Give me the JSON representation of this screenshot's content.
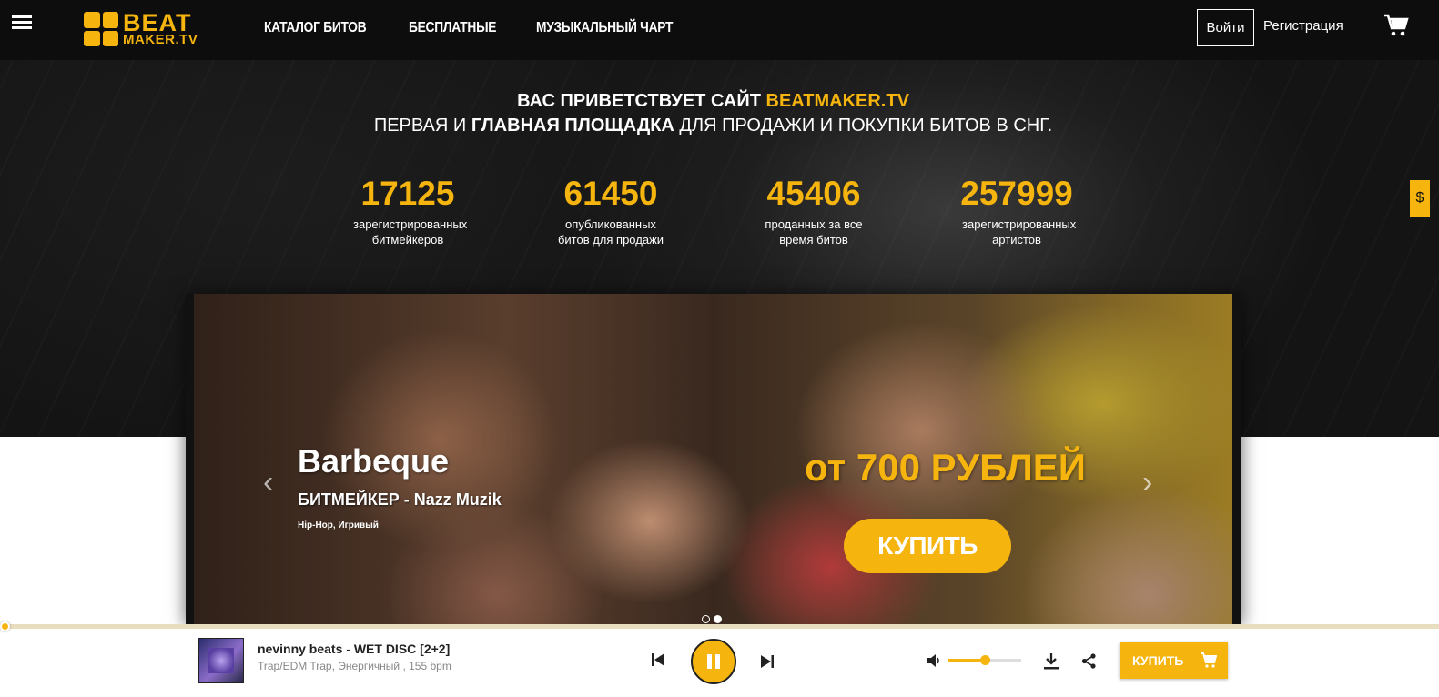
{
  "header": {
    "logo_line1": "BEAT",
    "logo_line2": "MAKER.TV",
    "nav": [
      "КАТАЛОГ БИТОВ",
      "БЕСПЛАТНЫЕ",
      "МУЗЫКАЛЬНЫЙ ЧАРТ"
    ],
    "login_label": "Войти",
    "register_label": "Регистрация"
  },
  "welcome": {
    "line1_prefix": "ВАС ПРИВЕТСТВУЕТ САЙТ ",
    "line1_site": "BEATMAKER.TV",
    "line2_a": "ПЕРВАЯ И ",
    "line2_bold": "ГЛАВНАЯ ПЛОЩАДКА",
    "line2_b": " ДЛЯ ПРОДАЖИ И ПОКУПКИ БИТОВ В СНГ."
  },
  "stats": [
    {
      "value": "17125",
      "label": "зарегистрированных битмейкеров"
    },
    {
      "value": "61450",
      "label": "опубликованных битов для продажи"
    },
    {
      "value": "45406",
      "label": "проданных за все время битов"
    },
    {
      "value": "257999",
      "label": "зарегистрированных артистов"
    }
  ],
  "currency_tab": "$",
  "slide": {
    "title": "Barbeque",
    "maker": "БИТМЕЙКЕР - Nazz Muzik",
    "genres": "Hip-Hop, Игривый",
    "price": "от 700 РУБЛЕЙ",
    "buy_label": "КУПИТЬ",
    "prev_arrow": "‹",
    "next_arrow": "›",
    "dots": 2,
    "active_dot": 2
  },
  "player": {
    "artist": "nevinny beats",
    "separator": " - ",
    "title": "WET DISC [2+2]",
    "meta": "Trap/EDM Trap, Энергичный , 155 bpm",
    "buy_label": "КУПИТЬ",
    "progress": 0.0,
    "volume": 0.5,
    "accent": "#f5b40e"
  }
}
